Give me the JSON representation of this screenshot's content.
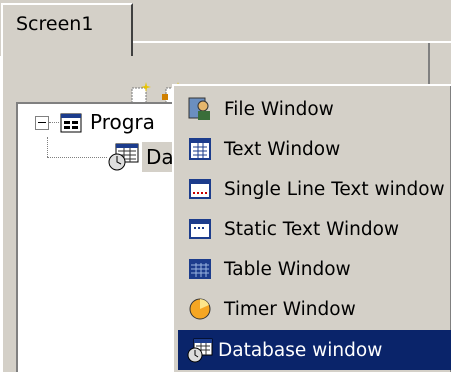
{
  "tab": {
    "label": "Screen1"
  },
  "toolbar": {
    "buttons": [
      {
        "icon": "new-icon"
      },
      {
        "icon": "new-child-icon"
      },
      {
        "icon": "copy-icon"
      },
      {
        "icon": "paste-icon"
      },
      {
        "icon": "delete-icon"
      },
      {
        "icon": "move-up-icon"
      },
      {
        "icon": "undo-icon"
      }
    ]
  },
  "tree": {
    "root_label": "Progra",
    "child_label": "Da"
  },
  "menu": {
    "items": [
      {
        "label": "File Window",
        "icon": "file-window-icon"
      },
      {
        "label": "Text Window",
        "icon": "text-window-icon"
      },
      {
        "label": "Single Line Text window",
        "icon": "single-line-text-icon"
      },
      {
        "label": "Static Text Window",
        "icon": "static-text-icon"
      },
      {
        "label": "Table Window",
        "icon": "table-window-icon"
      },
      {
        "label": "Timer Window",
        "icon": "timer-window-icon"
      },
      {
        "label": "Database window",
        "icon": "database-window-icon",
        "selected": true
      }
    ]
  },
  "colors": {
    "face": "#d4d0c8",
    "selection": "#0a246a",
    "delete_red": "#cc0000"
  }
}
